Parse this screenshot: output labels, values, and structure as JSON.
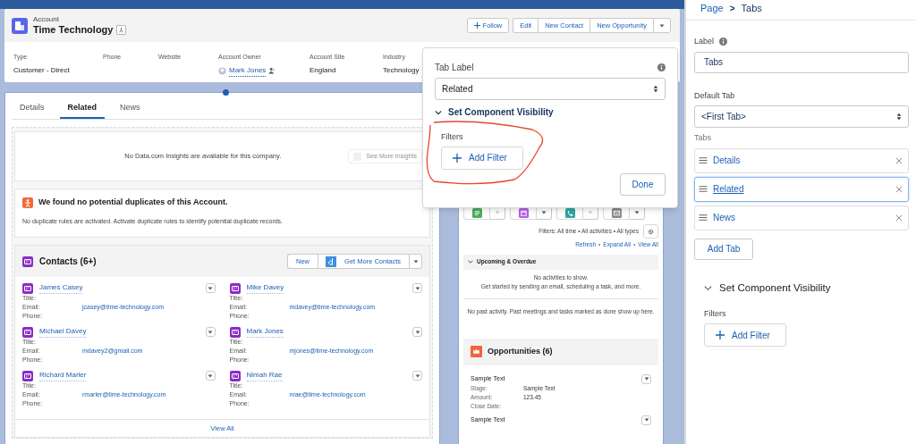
{
  "record_header": {
    "object_label": "Account",
    "title": "Time Technology",
    "actions": [
      {
        "label": "Follow",
        "kind": "follow"
      },
      {
        "label": "Edit",
        "kind": "plain"
      },
      {
        "label": "New Contact",
        "kind": "plain"
      },
      {
        "label": "New Opportunity",
        "kind": "plain"
      }
    ],
    "fields": [
      {
        "label": "Type",
        "value": "Customer - Direct",
        "kind": "text"
      },
      {
        "label": "Phone"
      },
      {
        "label": "Website"
      },
      {
        "label": "Account Owner",
        "value": "Mark Jones",
        "kind": "user"
      },
      {
        "label": "Account Site",
        "value": "England",
        "kind": "text"
      },
      {
        "label": "Industry",
        "value": "Technology",
        "kind": "text"
      }
    ]
  },
  "record_tabs": [
    {
      "label": "Details",
      "selected": false
    },
    {
      "label": "Related",
      "selected": true
    },
    {
      "label": "News",
      "selected": false
    }
  ],
  "insights": {
    "message": "No Data.com Insights are available for this company.",
    "button": "See More Insights",
    "button_disabled": true
  },
  "duplicates": {
    "title": "We found no potential duplicates of this Account.",
    "message": "No duplicate rules are activated. Activate duplicate rules to identify potential duplicate records."
  },
  "contacts": {
    "title": "Contacts (6+)",
    "actions": [
      "New",
      "Get More Contacts"
    ],
    "items": [
      {
        "name": "James Casey",
        "fields": [
          {
            "label": "Title:"
          },
          {
            "label": "Email:",
            "value": "jcasey@time-technology.com"
          },
          {
            "label": "Phone:"
          }
        ]
      },
      {
        "name": "Mike Davey",
        "fields": [
          {
            "label": "Title:"
          },
          {
            "label": "Email:",
            "value": "mdavey@time-technology.com"
          },
          {
            "label": "Phone:"
          }
        ]
      },
      {
        "name": "Michael Davey",
        "fields": [
          {
            "label": "Title:"
          },
          {
            "label": "Email:",
            "value": "mdavey2@gmail.com"
          },
          {
            "label": "Phone:"
          }
        ]
      },
      {
        "name": "Mark Jones",
        "fields": [
          {
            "label": "Title:"
          },
          {
            "label": "Email:",
            "value": "mjones@time-technology.com"
          },
          {
            "label": "Phone:"
          }
        ]
      },
      {
        "name": "Richard Marler",
        "fields": [
          {
            "label": "Title:"
          },
          {
            "label": "Email:",
            "value": "rmarler@time-technology.com"
          },
          {
            "label": "Phone:"
          }
        ]
      },
      {
        "name": "Nimah Rae",
        "fields": [
          {
            "label": "Title:"
          },
          {
            "label": "Email:",
            "value": "nrae@time-technology.com"
          },
          {
            "label": "Phone:"
          }
        ]
      }
    ],
    "view_all": "View All"
  },
  "activity": {
    "composer": [
      {
        "kind": "task",
        "caret_disabled": true
      },
      {
        "kind": "event",
        "caret_disabled": false
      },
      {
        "kind": "call",
        "caret_disabled": true
      },
      {
        "kind": "email",
        "caret_disabled": false
      }
    ],
    "filters": "Filters: All time • All activities • All types",
    "links": [
      "Refresh",
      "Expand All",
      "View All"
    ],
    "link_separator": "•",
    "section": "Upcoming & Overdue",
    "empty_lines": [
      "No activities to show.",
      "Get started by sending an email, scheduling a task, and more."
    ],
    "past": "No past activity. Past meetings and tasks marked as done show up here."
  },
  "opportunities": {
    "title": "Opportunities (6)",
    "items": [
      {
        "name": "Sample Text",
        "fields": [
          {
            "label": "Stage:",
            "value": "Sample Text"
          },
          {
            "label": "Amount:",
            "value": "123.45"
          },
          {
            "label": "Close Date:"
          }
        ]
      },
      {
        "name": "Sample Text"
      }
    ]
  },
  "tab_popover": {
    "label": "Tab Label",
    "value": "Related",
    "visibility_heading": "Set Component Visibility",
    "filters_label": "Filters",
    "add_filter": "Add Filter",
    "done": "Done"
  },
  "properties_panel": {
    "breadcrumb": [
      "Page",
      "Tabs"
    ],
    "separator": ">",
    "label_label": "Label",
    "label_value": "Tabs",
    "default_tab_label": "Default Tab",
    "default_tab_value": "<First Tab>",
    "tabs_label": "Tabs",
    "tabs": [
      {
        "label": "Details",
        "selected": false
      },
      {
        "label": "Related",
        "selected": true
      },
      {
        "label": "News",
        "selected": false
      }
    ],
    "add_tab": "Add Tab",
    "visibility_heading": "Set Component Visibility",
    "filters_label": "Filters",
    "add_filter": "Add Filter"
  }
}
